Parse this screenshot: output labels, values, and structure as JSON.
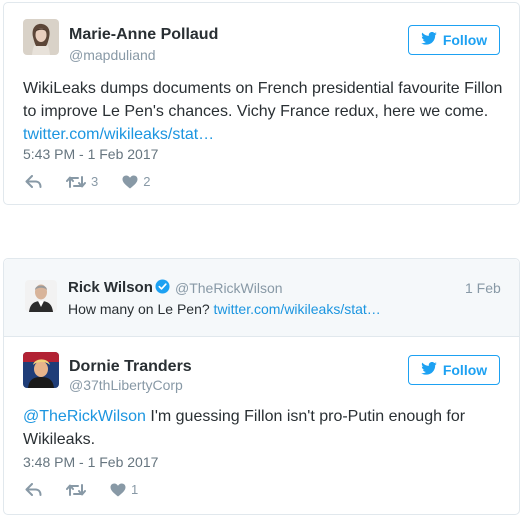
{
  "tweet1": {
    "name": "Marie-Anne Pollaud",
    "handle": "@mapduliand",
    "follow_label": "Follow",
    "text_plain": "WikiLeaks dumps documents on French presidential favourite Fillon to improve Le Pen's chances. Vichy France redux, here we come. ",
    "text_link": "twitter.com/wikileaks/stat…",
    "timestamp": "5:43 PM - 1 Feb 2017",
    "retweets": "3",
    "likes": "2"
  },
  "quoted": {
    "name": "Rick Wilson",
    "handle": "@TheRickWilson",
    "date": "1 Feb",
    "text_plain": "How many on Le Pen? ",
    "text_link": "twitter.com/wikileaks/stat…"
  },
  "tweet2": {
    "name": "Dornie Tranders",
    "handle": "@37thLibertyCorp",
    "follow_label": "Follow",
    "text_mention": "@TheRickWilson",
    "text_plain": " I'm guessing Fillon isn't pro-Putin enough for Wikileaks.",
    "timestamp": "3:48 PM - 1 Feb 2017",
    "likes": "1"
  },
  "icons": {
    "twitter_bird": "twitter-bird-icon",
    "reply": "reply-icon",
    "retweet": "retweet-icon",
    "like": "heart-icon",
    "verified": "verified-badge-icon"
  },
  "colors": {
    "accent": "#1da1f2",
    "link": "#1b95e0",
    "muted": "#8899a6",
    "border": "#e1e8ed",
    "quote_bg": "#f5f8fa"
  }
}
